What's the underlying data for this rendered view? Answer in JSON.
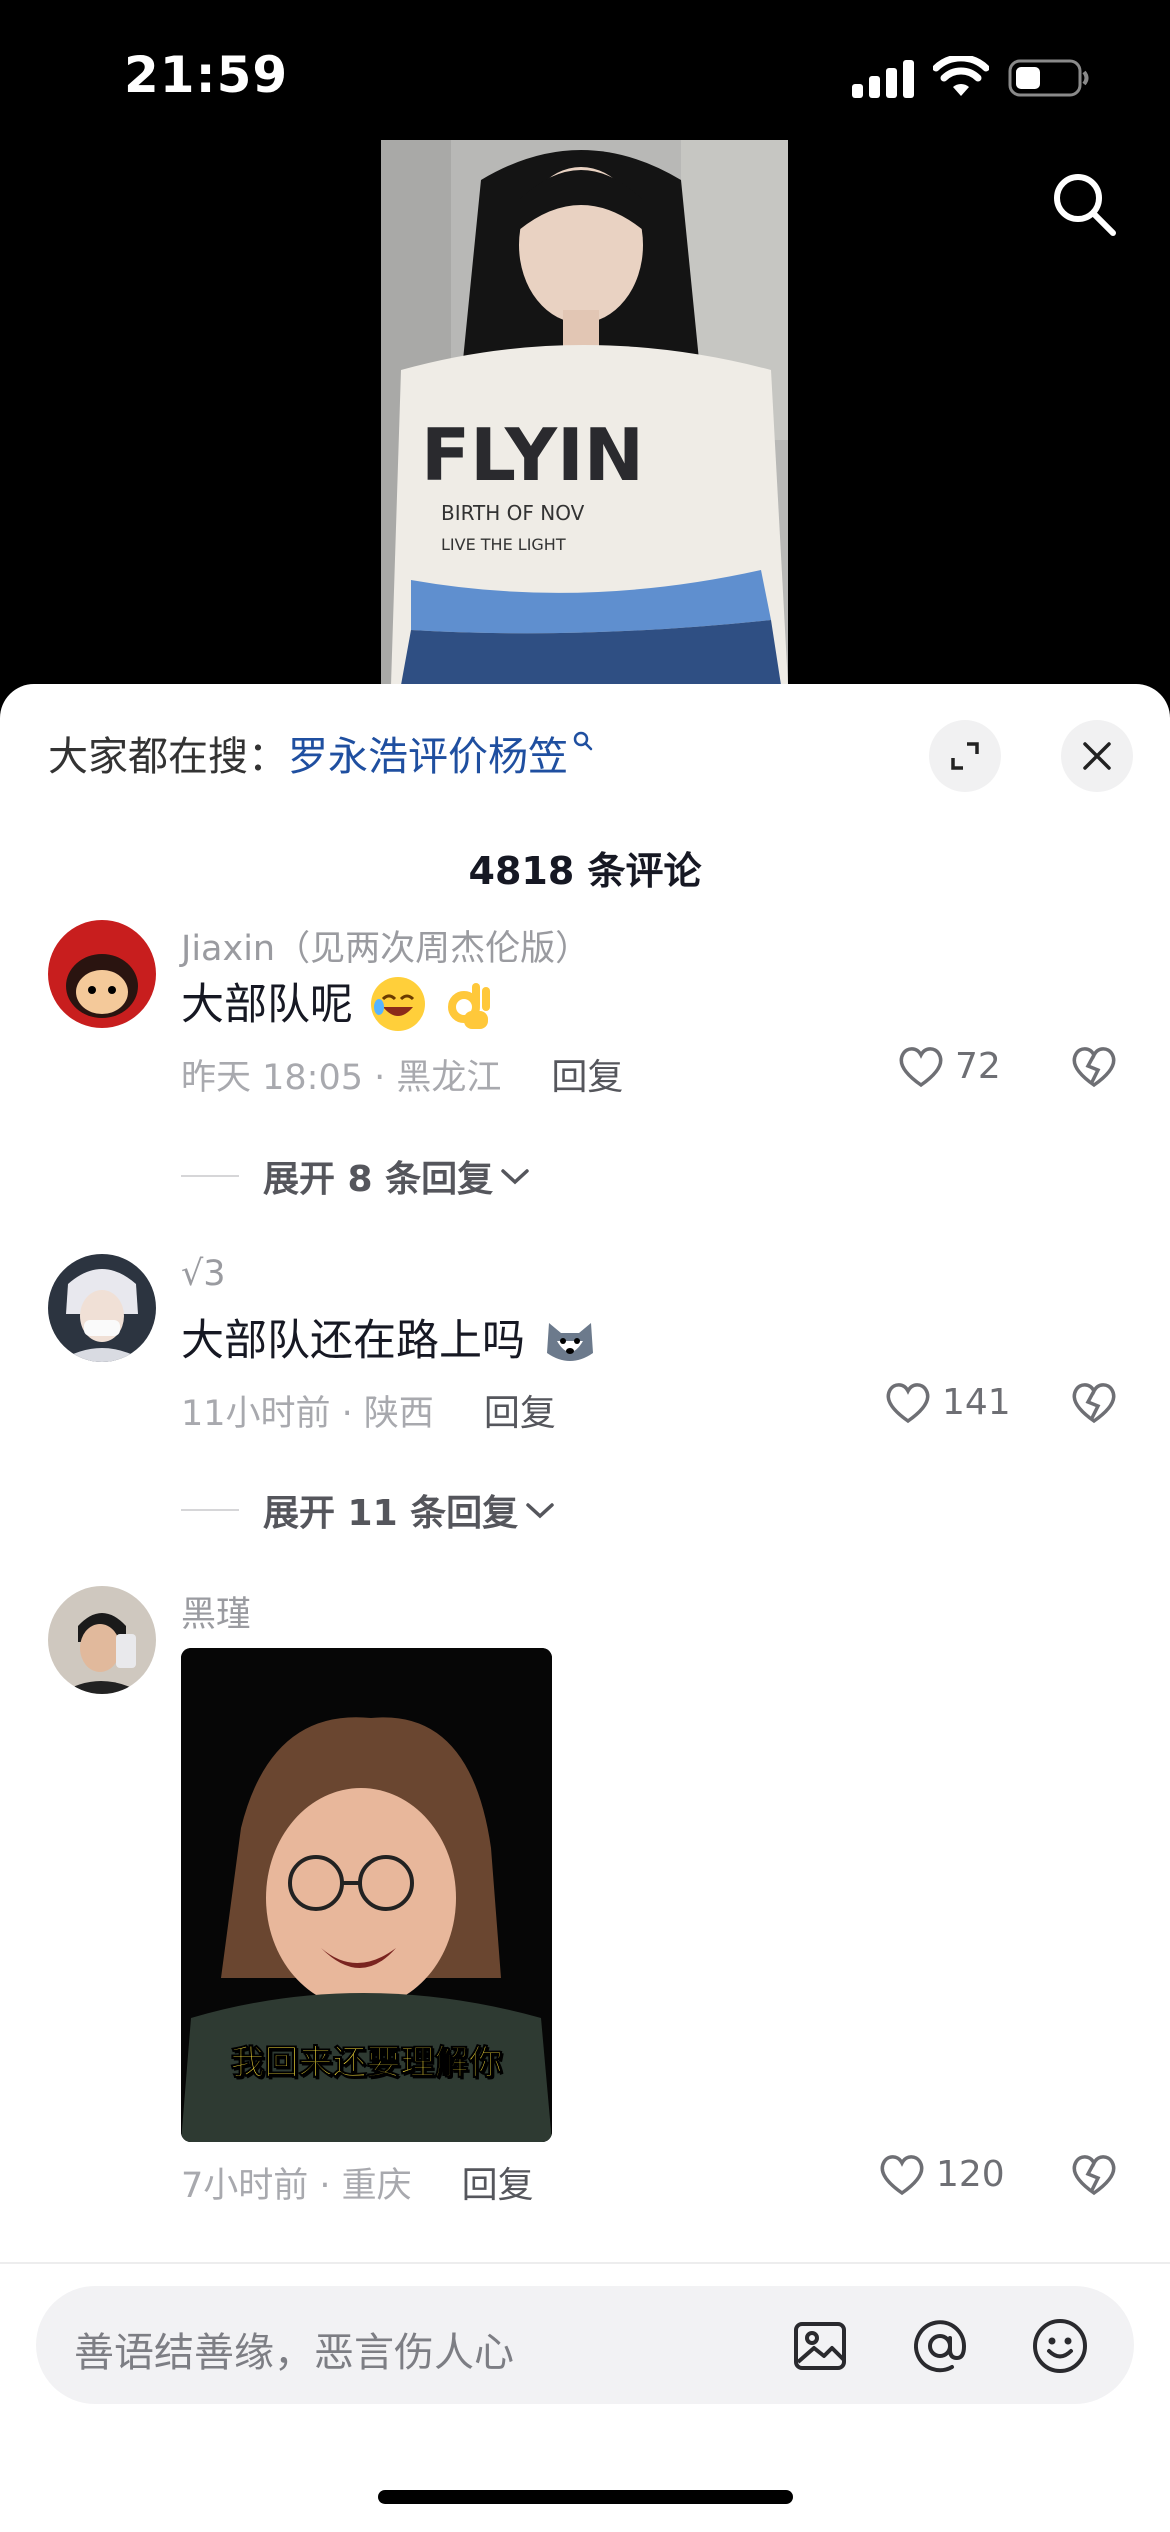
{
  "status_bar": {
    "time": "21:59"
  },
  "search": {
    "prefix": "大家都在搜：",
    "query": "罗永浩评价杨笠"
  },
  "comment_count": "4818 条评论",
  "comments": [
    {
      "user": "Jiaxin（见两次周杰伦版）",
      "text": "大部队呢",
      "time_location": "昨天 18:05 · 黑龙江",
      "reply_label": "回复",
      "likes": "72",
      "expand_label": "展开 8 条回复"
    },
    {
      "user": "√3",
      "text": "大部队还在路上吗",
      "time_location": "11小时前 · 陕西",
      "reply_label": "回复",
      "likes": "141",
      "expand_label": "展开 11 条回复"
    },
    {
      "user": "黑瑾",
      "image_caption": "我回来还要理解你",
      "time_location": "7小时前 · 重庆",
      "reply_label": "回复",
      "likes": "120"
    }
  ],
  "input": {
    "placeholder": "善语结善缘，恶言伤人心"
  },
  "colors": {
    "link": "#1f4fa0",
    "sheet_bg": "#ffffff",
    "text": "#161823",
    "muted": "#a8a9ae"
  },
  "icons": [
    "search-icon",
    "expand-icon",
    "close-icon",
    "heart-icon",
    "dislike-icon",
    "image-icon",
    "at-icon",
    "emoji-icon"
  ]
}
